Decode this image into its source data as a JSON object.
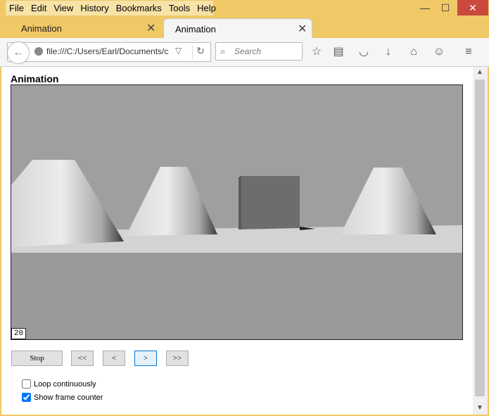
{
  "menu": [
    "File",
    "Edit",
    "View",
    "History",
    "Bookmarks",
    "Tools",
    "Help"
  ],
  "window_controls": {
    "minimize": "—",
    "maximize": "☐",
    "close": "✕"
  },
  "tabs": [
    {
      "label": "Animation",
      "active": false
    },
    {
      "label": "Animation",
      "active": true
    }
  ],
  "new_tab": "+",
  "nav": {
    "url": "file:///C:/Users/Earl/Documents/c",
    "search_placeholder": "Search"
  },
  "page": {
    "title": "Animation",
    "frame_counter": "20",
    "buttons": {
      "stop": "Stop",
      "first": "<<",
      "prev": "<",
      "next": ">",
      "last": ">>"
    },
    "options": {
      "loop_label": "Loop continuously",
      "loop_checked": false,
      "counter_label": "Show frame counter",
      "counter_checked": true
    }
  },
  "colors": {
    "titlebar": "#f0c866",
    "viewport_bg": "#9f9f9f",
    "close_button": "#c94a3c"
  }
}
